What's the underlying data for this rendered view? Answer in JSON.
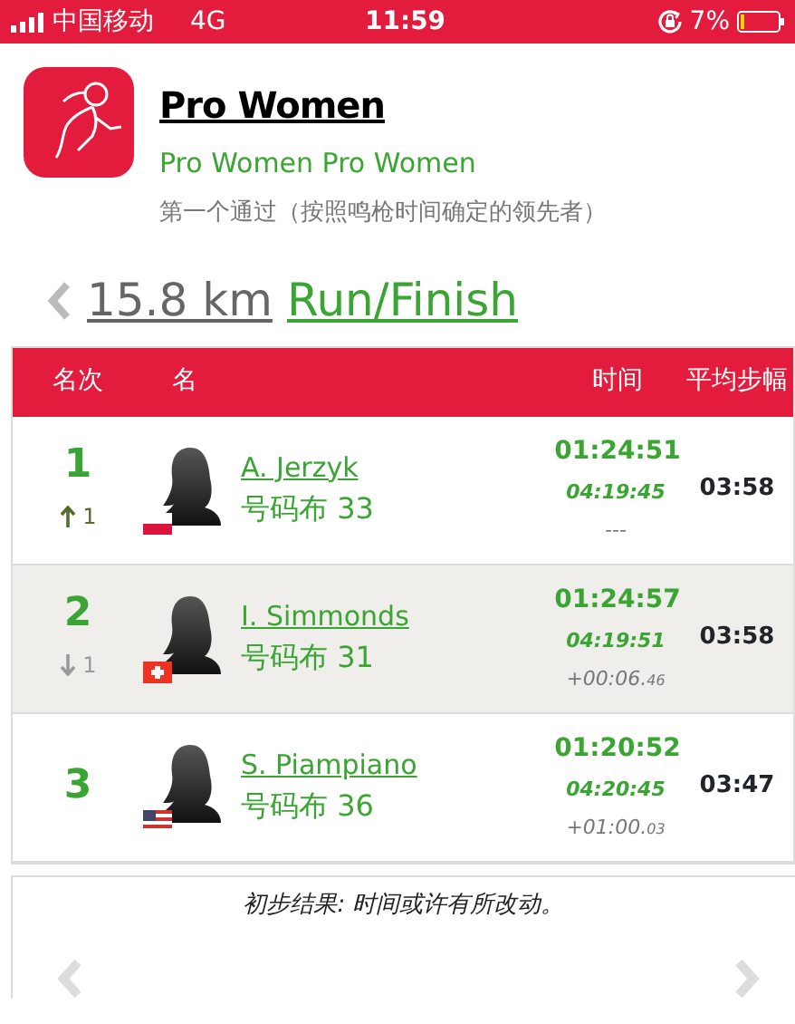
{
  "status_bar": {
    "carrier": "中国移动",
    "network": "4G",
    "time": "11:59",
    "battery": "7%"
  },
  "header": {
    "title": "Pro Women",
    "subtitle": "Pro Women Pro Women",
    "description": "第一个通过（按照鸣枪时间确定的领先者）"
  },
  "split": {
    "distance": "15.8 km",
    "name": "Run/Finish"
  },
  "table": {
    "columns": [
      "名次",
      "名",
      "时间",
      "平均步幅"
    ],
    "rows": [
      {
        "rank": "1",
        "rank_change": {
          "kind": "up",
          "value": "1"
        },
        "flag": {
          "kind": "poland"
        },
        "name": "A. Jerzyk",
        "bib": "号码布 33",
        "time": "01:24:51",
        "split_time": "04:19:45",
        "gap": "---",
        "pace": "03:58"
      },
      {
        "rank": "2",
        "rank_change": {
          "kind": "down",
          "value": "1"
        },
        "flag": {
          "kind": "switzerland"
        },
        "name": "I. Simmonds",
        "bib": "号码布 31",
        "time": "01:24:57",
        "split_time": "04:19:51",
        "gap": "+00:06.",
        "gap_fraction": "46",
        "pace": "03:58"
      },
      {
        "rank": "3",
        "flag": {
          "kind": "usa"
        },
        "name": "S. Piampiano",
        "bib": "号码布 36",
        "time": "01:20:52",
        "split_time": "04:20:45",
        "gap": "+01:00.",
        "gap_fraction": "03",
        "pace": "03:47"
      }
    ]
  },
  "footer_note": "初步结果: 时间或许有所改动。"
}
